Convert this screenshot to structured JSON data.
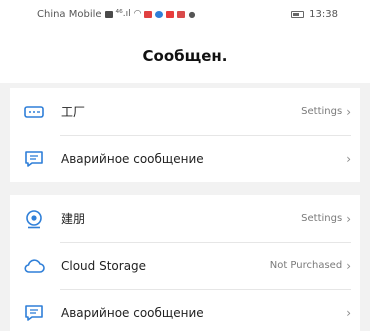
{
  "status_bar": {
    "carrier": "China Mobile",
    "signal_text": "⁴⁶.ıl",
    "time": "13:38"
  },
  "header": {
    "title": "Сообщен."
  },
  "groups": [
    {
      "rows": [
        {
          "icon": "nvr-device-icon",
          "label": "工厂",
          "right": "Settings",
          "chevron": "›"
        },
        {
          "icon": "message-icon",
          "label": "Аварийное сообщение",
          "right": "",
          "chevron": "›"
        }
      ]
    },
    {
      "rows": [
        {
          "icon": "camera-icon",
          "label": "建朋",
          "right": "Settings",
          "chevron": "›"
        },
        {
          "icon": "cloud-icon",
          "label": "Cloud Storage",
          "right": "Not Purchased",
          "chevron": "›"
        },
        {
          "icon": "message-icon",
          "label": "Аварийное сообщение",
          "right": "",
          "chevron": "›"
        }
      ]
    }
  ],
  "colors": {
    "accent": "#2f7fd8",
    "background": "#f2f2f2"
  }
}
